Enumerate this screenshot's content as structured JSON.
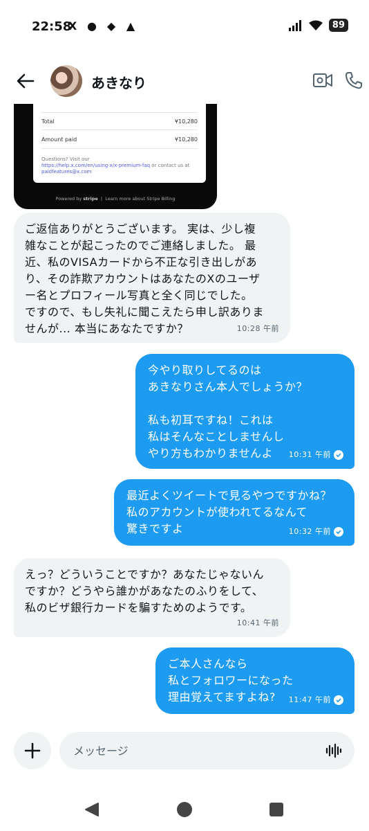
{
  "status_bar": {
    "time": "22:58",
    "app_icons": [
      "X",
      "●",
      "◆",
      "▲"
    ],
    "battery": "89"
  },
  "header": {
    "contact_name": "あきなり"
  },
  "receipt": {
    "total_label": "Total",
    "total_value": "¥10,280",
    "paid_label": "Amount paid",
    "paid_value": "¥10,280",
    "questions_text": "Questions? Visit our",
    "help_link": "https://help.x.com/en/using-x/x-premium-faq",
    "contact_text": "or contact us at",
    "email": "paidfeatures@x.com",
    "powered_by": "Powered by",
    "stripe": "stripe",
    "learn_more": "Learn more about Stripe Billing"
  },
  "messages": [
    {
      "dir": "in",
      "text": "ご返信ありがとうございます。 実は、少し複\n雑なことが起こったのでご連絡しました。 最\n近、私のVISAカードから不正な引き出しがあ\nり、その詐欺アカウントはあなたのXのユーザ\nー名とプロフィール写真と全く同じでした。\nですので、もし失礼に聞こえたら申し訳ありま\nせんが... 本当にあなたですか？",
      "time": "10:28 午前"
    },
    {
      "dir": "out",
      "text": "今やり取りしてるのは\nあきなりさん本人でしょうか？\n\n私も初耳ですね！これは\n私はそんなことしませんし\nやり方もわかりませんよ",
      "time": "10:31 午前"
    },
    {
      "dir": "out",
      "text": "最近よくツイートで見るやつですかね？\n私のアカウントが使われてるなんて\n驚きですよ",
      "time": "10:32 午前"
    },
    {
      "dir": "in",
      "text": "えっ？どういうことですか？あなたじゃないん\nですか？どうやら誰かがあなたのふりをして、\n私のビザ銀行カードを騙すためのようです。",
      "time": "10:41 午前"
    },
    {
      "dir": "out",
      "text": "ご本人さんなら\n私とフォロワーになった\n理由覚えてますよね?",
      "time": "11:47 午前"
    }
  ],
  "composer": {
    "placeholder": "メッセージ"
  },
  "colors": {
    "outgoing_bubble": "#1d9bf0",
    "incoming_bubble": "#eff3f4"
  }
}
